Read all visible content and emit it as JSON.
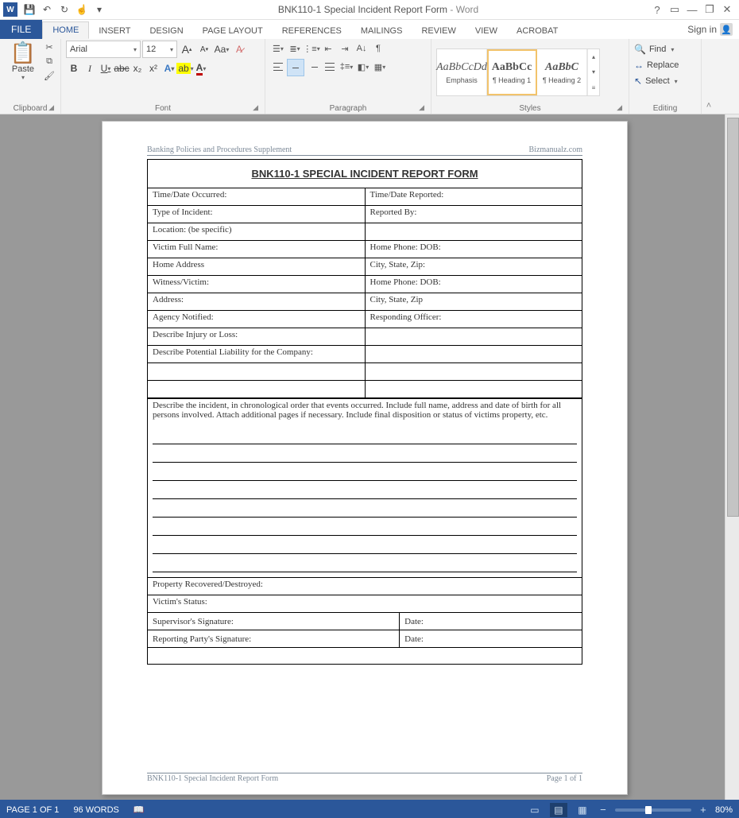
{
  "title": {
    "doc": "BNK110-1 Special Incident Report Form",
    "app": "Word"
  },
  "qat": {
    "save": "💾",
    "undo": "↶",
    "redo": "↻",
    "touch": "☝"
  },
  "win": {
    "help": "?",
    "ribbon_opts": "▭",
    "min": "—",
    "restore": "❐",
    "close": "✕"
  },
  "signin": "Sign in",
  "tabs": {
    "file": "FILE",
    "home": "HOME",
    "insert": "INSERT",
    "design": "DESIGN",
    "page_layout": "PAGE LAYOUT",
    "references": "REFERENCES",
    "mailings": "MAILINGS",
    "review": "REVIEW",
    "view": "VIEW",
    "acrobat": "ACROBAT"
  },
  "ribbon": {
    "clipboard": {
      "label": "Clipboard",
      "paste": "Paste"
    },
    "font": {
      "label": "Font",
      "name": "Arial",
      "size": "12",
      "grow": "A",
      "shrink": "A",
      "case": "Aa",
      "clear": "A",
      "bold": "B",
      "italic": "I",
      "underline": "U",
      "strike": "abc",
      "sub": "x₂",
      "sup": "x²",
      "effects": "A",
      "highlight": "ab",
      "color": "A"
    },
    "paragraph": {
      "label": "Paragraph",
      "pilcrow": "¶"
    },
    "styles": {
      "label": "Styles",
      "items": [
        {
          "preview": "AaBbCcDd",
          "name": "Emphasis",
          "style": "italic"
        },
        {
          "preview": "AaBbCc",
          "name": "¶ Heading 1",
          "style": "bold"
        },
        {
          "preview": "AaBbC",
          "name": "¶ Heading 2",
          "style": "bolditalic"
        }
      ]
    },
    "editing": {
      "label": "Editing",
      "find": "Find",
      "replace": "Replace",
      "select": "Select"
    }
  },
  "doc": {
    "header_left": "Banking Policies and Procedures Supplement",
    "header_right": "Bizmanualz.com",
    "form_title": "BNK110-1 SPECIAL INCIDENT REPORT FORM",
    "rows": [
      [
        "Time/Date Occurred:",
        "Time/Date Reported:"
      ],
      [
        "Type of Incident:",
        "Reported By:"
      ],
      [
        "Location:  (be specific)",
        ""
      ],
      [
        "Victim Full Name:",
        "Home Phone:                    DOB:"
      ],
      [
        "Home Address",
        "City, State, Zip:"
      ],
      [
        "Witness/Victim:",
        "Home Phone:                    DOB:"
      ],
      [
        "Address:",
        "City, State, Zip"
      ],
      [
        "Agency Notified:",
        "Responding Officer:"
      ],
      [
        "Describe Injury or Loss:",
        ""
      ],
      [
        "Describe Potential Liability for the Company:",
        ""
      ],
      [
        "",
        ""
      ],
      [
        "",
        ""
      ]
    ],
    "narrative": "Describe the incident, in chronological order that events occurred.  Include full name, address and date of birth for all persons involved.  Attach additional pages if necessary.  Include final disposition or status of victims property, etc.",
    "bottom_full": [
      "Property Recovered/Destroyed:",
      "Victim's Status:"
    ],
    "sig_rows": [
      [
        "Supervisor's Signature:",
        "Date:"
      ],
      [
        "Reporting Party's Signature:",
        "Date:"
      ]
    ],
    "footer_left": "BNK110-1 Special Incident Report Form",
    "footer_right": "Page 1 of 1"
  },
  "status": {
    "page": "PAGE 1 OF 1",
    "words": "96 WORDS",
    "zoom": "80%"
  }
}
